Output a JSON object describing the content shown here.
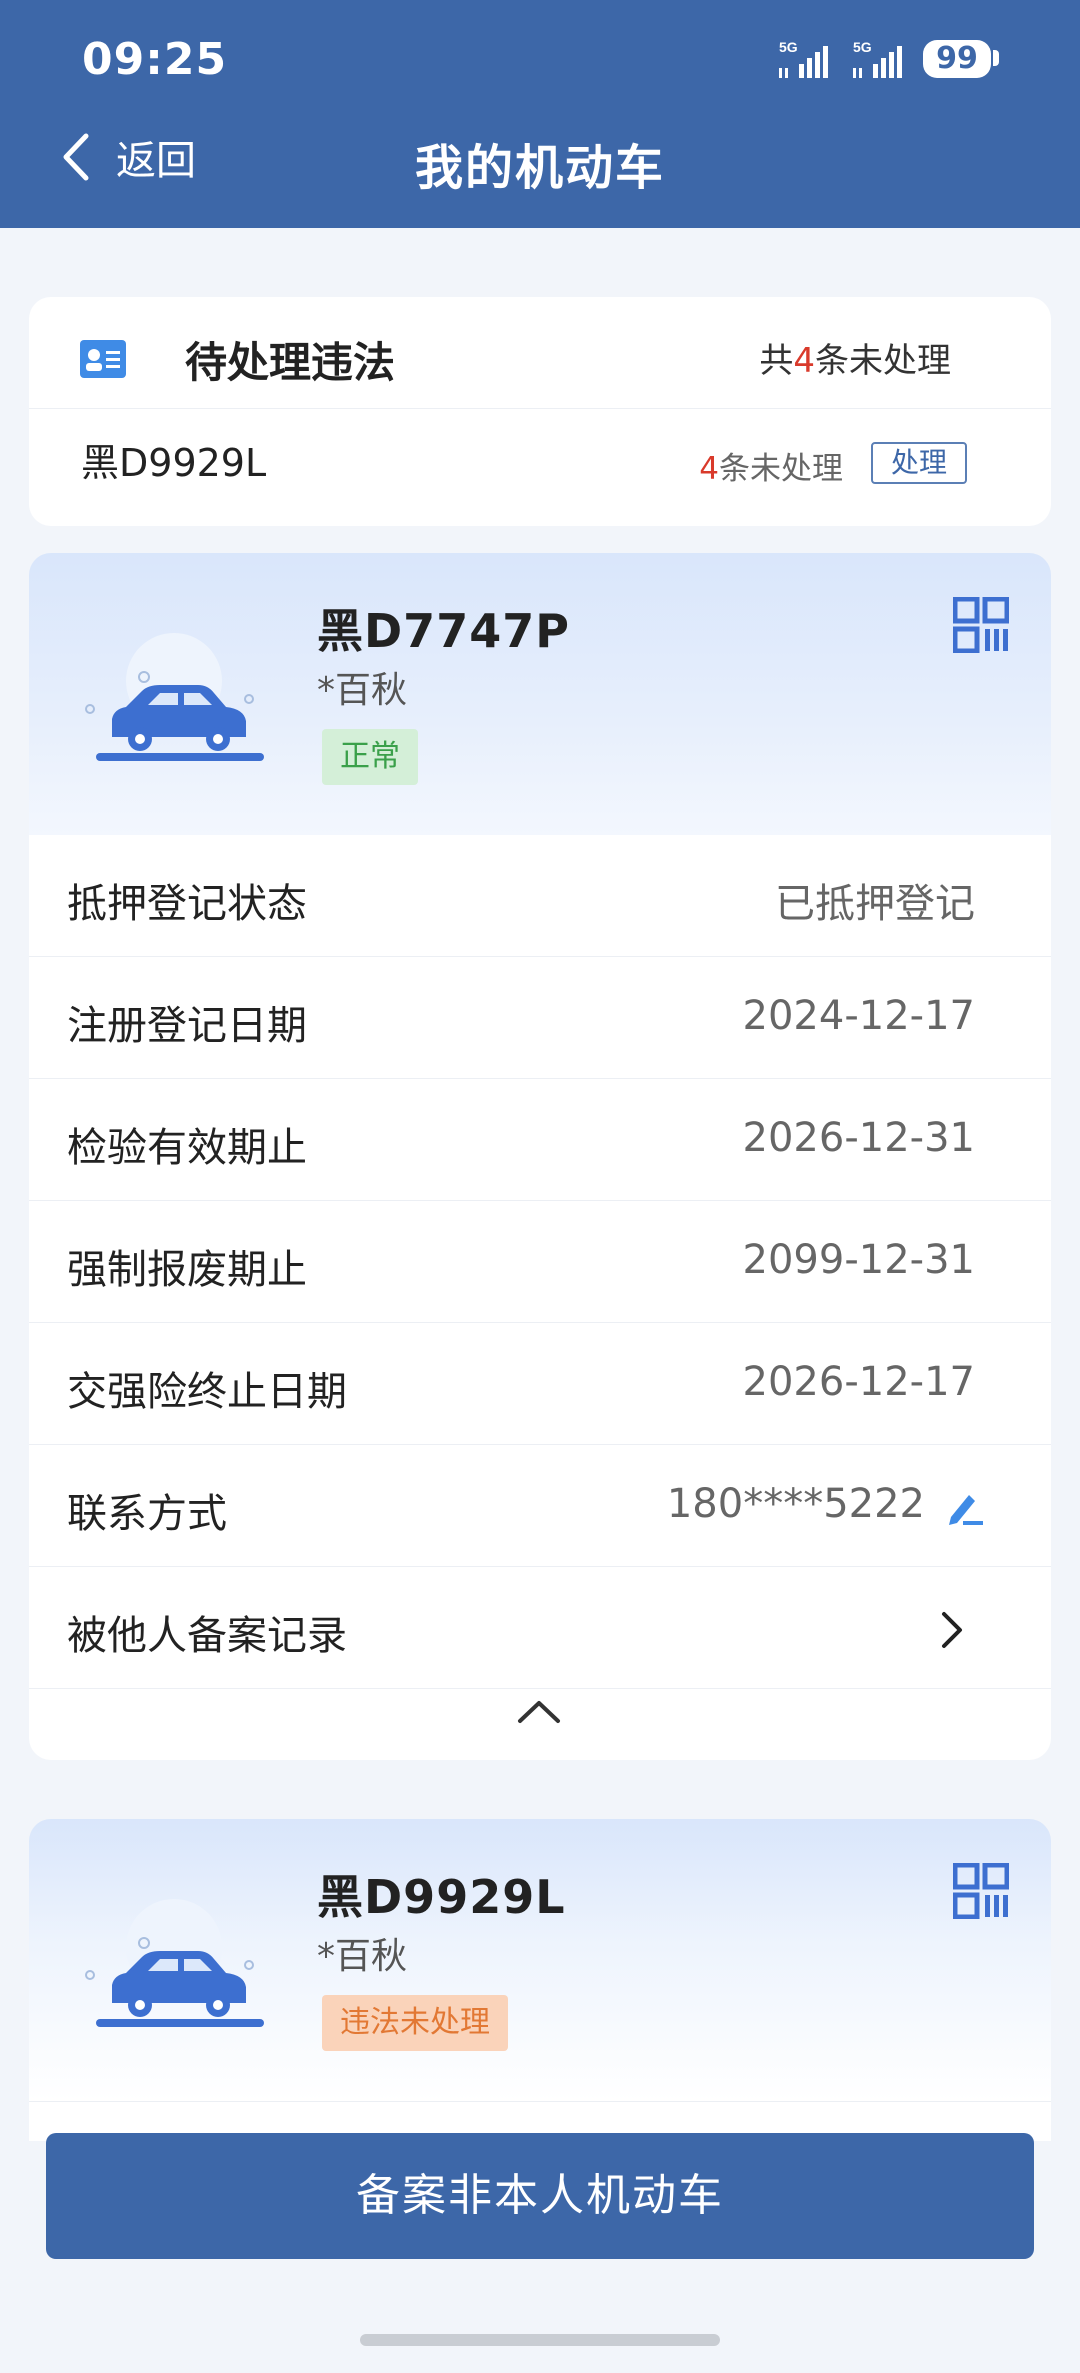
{
  "status_bar": {
    "time": "09:25",
    "signal_1": "5G",
    "signal_2": "5G",
    "battery": "99"
  },
  "nav": {
    "back_label": "返回",
    "title": "我的机动车"
  },
  "violations": {
    "title": "待处理违法",
    "total_prefix": "共",
    "total_count": "4",
    "total_suffix": "条未处理",
    "items": [
      {
        "plate": "黑D9929L",
        "count": "4",
        "count_suffix": "条未处理",
        "action": "处理"
      }
    ]
  },
  "vehicles": [
    {
      "plate": "黑D7747P",
      "owner": "*百秋",
      "status": "正常",
      "status_color": "#3aa04a",
      "details": [
        {
          "label": "抵押登记状态",
          "value": "已抵押登记"
        },
        {
          "label": "注册登记日期",
          "value": "2024-12-17"
        },
        {
          "label": "检验有效期止",
          "value": "2026-12-31"
        },
        {
          "label": "强制报废期止",
          "value": "2099-12-31"
        },
        {
          "label": "交强险终止日期",
          "value": "2026-12-17"
        },
        {
          "label": "联系方式",
          "value": "180****5222"
        },
        {
          "label": "被他人备案记录",
          "value": ""
        }
      ]
    },
    {
      "plate": "黑D9929L",
      "owner": "*百秋",
      "status": "违法未处理",
      "status_color": "#e27834"
    }
  ],
  "footer": {
    "button_label": "备案非本人机动车"
  },
  "colors": {
    "primary": "#3d67a8",
    "warning_red": "#d93a2b"
  }
}
